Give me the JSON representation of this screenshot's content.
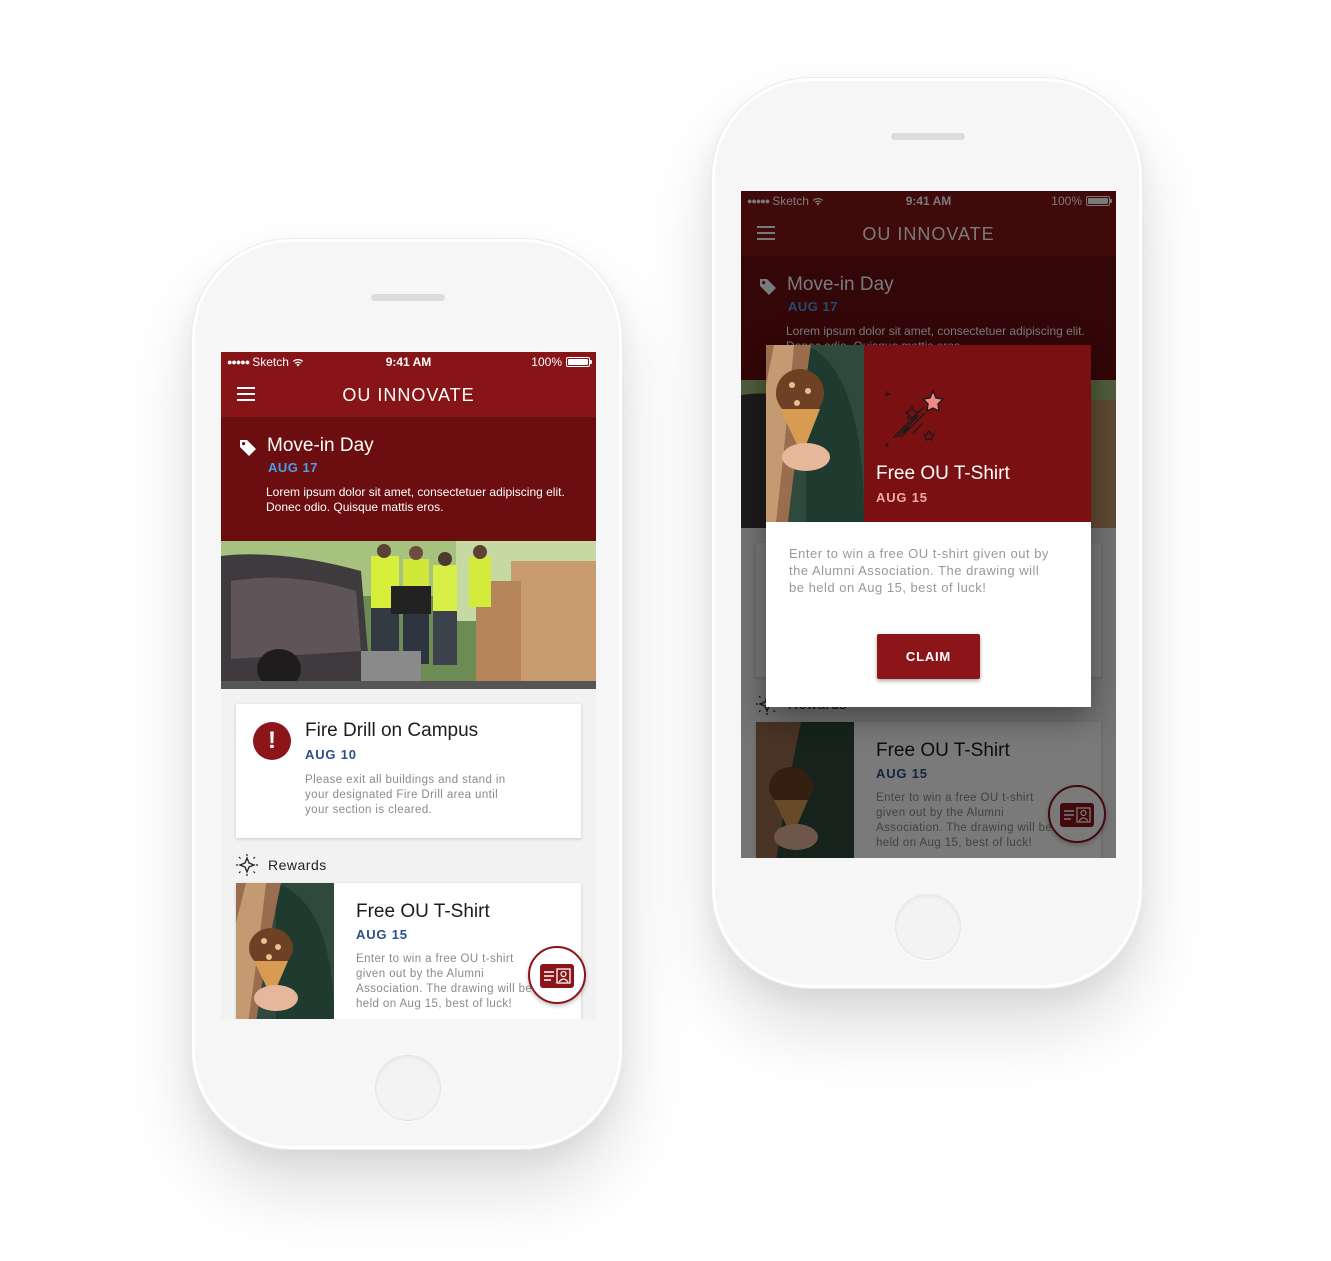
{
  "app": {
    "title": "OU INNOVATE",
    "brand_color": "#871518",
    "status_bar": {
      "carrier": "Sketch",
      "time": "9:41 AM",
      "battery": "100%"
    }
  },
  "hero_event": {
    "icon": "tag-icon",
    "title": "Move-in Day",
    "date": "AUG 17",
    "description": "Lorem ipsum dolor sit amet, consectetuer adipiscing elit. Donec odio. Quisque  mattis eros."
  },
  "alert_card": {
    "icon": "alert-icon",
    "icon_glyph": "!",
    "title": "Fire Drill on Campus",
    "date": "AUG 10",
    "description": "Please exit all buildings and stand in your designated Fire Drill area until your section is cleared."
  },
  "rewards_section": {
    "icon": "sparkle-icon",
    "label": "Rewards"
  },
  "reward_card": {
    "title": "Free OU T-Shirt",
    "date": "AUG 15",
    "description": "Enter to win a free OU t-shirt given out by the Alumni Association. The drawing will be held on Aug 15, best of luck!"
  },
  "fab": {
    "icon": "id-card-icon"
  },
  "claim_dialog": {
    "icon": "shooting-stars-icon",
    "title": "Free OU T-Shirt",
    "date": "AUG 15",
    "description": "Enter to win a free OU t-shirt given out by the Alumni Association. The drawing will be held on Aug 15, best of luck!",
    "claim_label": "CLAIM"
  }
}
